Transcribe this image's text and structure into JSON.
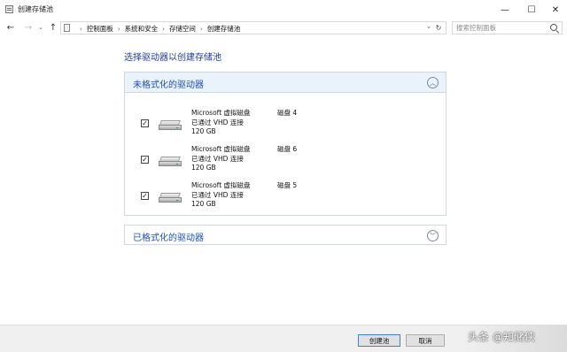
{
  "window": {
    "title": "创建存储池",
    "minimize_glyph": "—",
    "maximize_glyph": "☐",
    "close_glyph": "✕"
  },
  "nav": {
    "back_glyph": "←",
    "forward_glyph": "→",
    "recent_glyph": "⌄",
    "up_glyph": "↑"
  },
  "address": {
    "crumbs": [
      "控制面板",
      "系统和安全",
      "存储空间",
      "创建存储池"
    ],
    "separator": "›",
    "dropdown_glyph": "⌄",
    "refresh_glyph": "↻"
  },
  "search": {
    "placeholder": "搜索控制面板"
  },
  "main": {
    "heading": "选择驱动器以创建存储池",
    "unformatted": {
      "title": "未格式化的驱动器",
      "chevron": "︿",
      "drives": [
        {
          "name": "Microsoft 虚拟磁盘",
          "status": "已通过 VHD 连接",
          "size": "120 GB",
          "disk": "磁盘 4",
          "checked": "✓"
        },
        {
          "name": "Microsoft 虚拟磁盘",
          "status": "已通过 VHD 连接",
          "size": "120 GB",
          "disk": "磁盘 6",
          "checked": "✓"
        },
        {
          "name": "Microsoft 虚拟磁盘",
          "status": "已通过 VHD 连接",
          "size": "120 GB",
          "disk": "磁盘 5",
          "checked": "✓"
        }
      ]
    },
    "formatted": {
      "title": "已格式化的驱动器",
      "chevron": "﹀"
    }
  },
  "footer": {
    "create_label": "创建池",
    "cancel_label": "取消",
    "watermark": "头条 @知储侠"
  },
  "colors": {
    "heading": "#1e3e8c",
    "section_title": "#1e4fb4",
    "section_header_bg": "#eaf3fc",
    "footer_bg": "#f0f0f0"
  }
}
